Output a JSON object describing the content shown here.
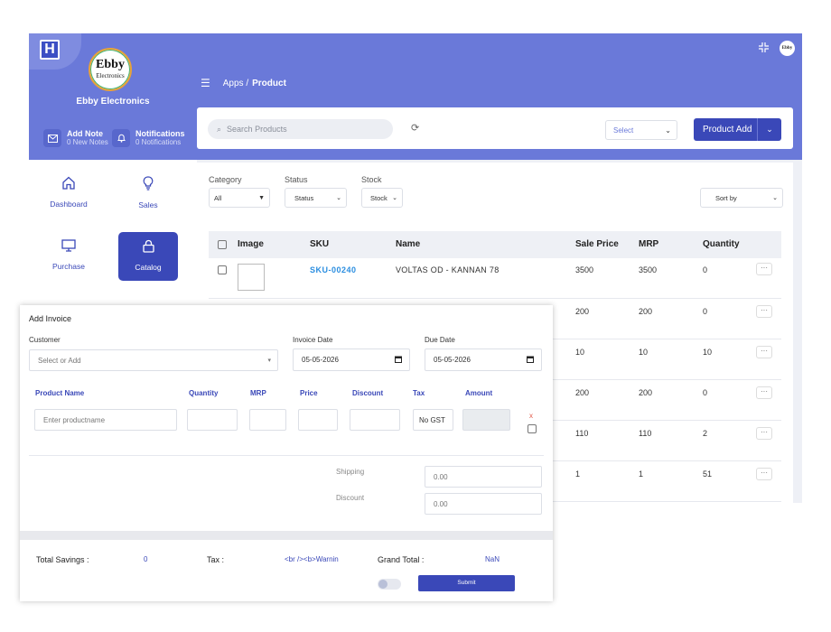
{
  "brand": {
    "logo_letter": "H",
    "store_logo_big": "Ebby",
    "store_logo_small": "Electronics",
    "store_name": "Ebby Electronics",
    "avatar_text": "Ebby"
  },
  "quick_actions": [
    {
      "title": "Add Note",
      "sub": "0 New Notes",
      "icon": "mail-icon"
    },
    {
      "title": "Notifications",
      "sub": "0 Notifications",
      "icon": "bell-icon"
    }
  ],
  "breadcrumb": {
    "apps": "Apps /",
    "page": "Product"
  },
  "toolbar": {
    "search_placeholder": "Search Products",
    "select_value": "Select",
    "add_label": "Product Add"
  },
  "sidebar": {
    "items": [
      {
        "label": "Dashboard",
        "icon": "home-icon"
      },
      {
        "label": "Sales",
        "icon": "bulb-icon"
      },
      {
        "label": "Purchase",
        "icon": "monitor-icon"
      },
      {
        "label": "Catalog",
        "icon": "lock-icon",
        "active": true
      }
    ]
  },
  "filters": {
    "category_label": "Category",
    "category_value": "All",
    "status_label": "Status",
    "status_value": "Status",
    "stock_label": "Stock",
    "stock_value": "Stock",
    "sort_value": "Sort by"
  },
  "table": {
    "headers": [
      "Image",
      "SKU",
      "Name",
      "Sale Price",
      "MRP",
      "Quantity"
    ],
    "rows": [
      {
        "sku": "SKU-00240",
        "name": "VOLTAS OD - KANNAN 78",
        "sale": "3500",
        "mrp": "3500",
        "qty": "0"
      },
      {
        "sale": "200",
        "mrp": "200",
        "qty": "0"
      },
      {
        "sale": "10",
        "mrp": "10",
        "qty": "10"
      },
      {
        "sale": "200",
        "mrp": "200",
        "qty": "0"
      },
      {
        "sale": "110",
        "mrp": "110",
        "qty": "2"
      },
      {
        "sale": "1",
        "mrp": "1",
        "qty": "51"
      }
    ],
    "more_glyph": "···"
  },
  "invoice": {
    "title": "Add Invoice",
    "customer_label": "Customer",
    "customer_placeholder": "Select or Add",
    "invoice_date_label": "Invoice Date",
    "invoice_date": "05-05-2026",
    "due_date_label": "Due Date",
    "due_date": "05-05-2026",
    "columns": [
      "Product Name",
      "Quantity",
      "MRP",
      "Price",
      "Discount",
      "Tax",
      "Amount"
    ],
    "product_placeholder": "Enter productname",
    "tax_value": "No GST",
    "remove_glyph": "x",
    "shipping_label": "Shipping",
    "shipping_value": "0.00",
    "discount_label": "Discount",
    "discount_value": "0.00",
    "total_savings_label": "Total Savings :",
    "total_savings_value": "0",
    "tax_label": "Tax :",
    "tax_html_text": "<br /><b>Warnin",
    "grand_total_label": "Grand Total :",
    "grand_total_value": "NaN",
    "submit_label": "Submit"
  },
  "colors": {
    "primary": "#6a79d9",
    "accent": "#3a48b8",
    "link": "#2b8ee0"
  }
}
